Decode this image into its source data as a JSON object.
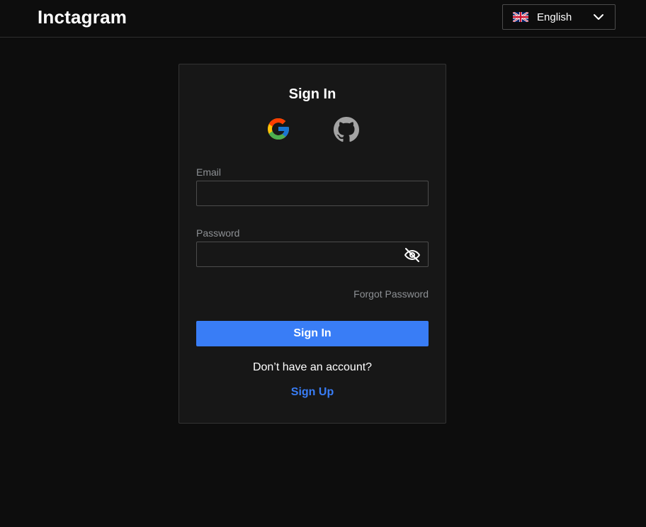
{
  "header": {
    "logo": "Inctagram",
    "language": {
      "selected": "English",
      "flag_icon": "uk-flag-icon",
      "chevron_icon": "chevron-down-icon"
    }
  },
  "signin_card": {
    "title": "Sign In",
    "oauth": [
      {
        "provider": "Google",
        "icon": "google-icon"
      },
      {
        "provider": "GitHub",
        "icon": "github-icon"
      }
    ],
    "email": {
      "label": "Email",
      "value": "",
      "placeholder": ""
    },
    "password": {
      "label": "Password",
      "value": "",
      "placeholder": "",
      "toggle_icon": "eye-off-icon"
    },
    "forgot_password": "Forgot Password",
    "submit_label": "Sign In",
    "no_account_text": "Don’t have an account?",
    "signup_label": "Sign Up"
  },
  "colors": {
    "background": "#0d0d0d",
    "card": "#171717",
    "accent": "#397df6",
    "muted_text": "#8d9094",
    "border": "#4c4c4c"
  }
}
